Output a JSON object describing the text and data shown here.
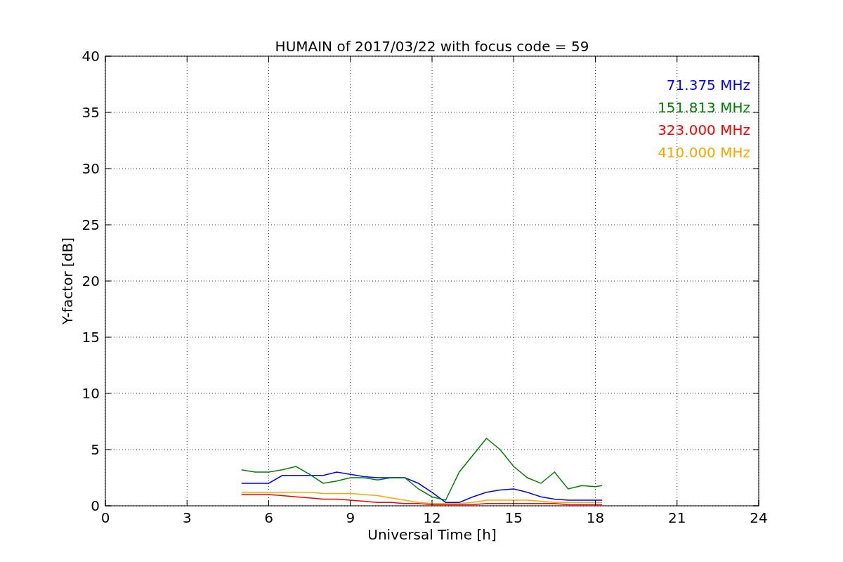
{
  "figure": {
    "chart_data": {
      "type": "line",
      "grid": true,
      "title": "HUMAIN of 2017/03/22 with focus code = 59",
      "xlabel": "Universal Time [h]",
      "ylabel": "Y-factor [dB]",
      "xlim": [
        0,
        24
      ],
      "ylim": [
        0,
        40
      ],
      "xticks": [
        0,
        3,
        6,
        9,
        12,
        15,
        18,
        21,
        24
      ],
      "yticks": [
        0,
        5,
        10,
        15,
        20,
        25,
        30,
        35,
        40
      ],
      "x": [
        5,
        5.5,
        6,
        6.5,
        7,
        7.5,
        8,
        8.5,
        9,
        9.5,
        10,
        10.5,
        11,
        11.5,
        12,
        12.5,
        13,
        13.5,
        14,
        14.5,
        15,
        15.5,
        16,
        16.5,
        17,
        17.5,
        18,
        18.25
      ],
      "series": [
        {
          "name": "71.375 MHz",
          "color": "#0000ff",
          "values": [
            2.0,
            2.0,
            2.0,
            2.7,
            2.7,
            2.7,
            2.7,
            3.0,
            2.8,
            2.6,
            2.5,
            2.5,
            2.5,
            2.0,
            1.2,
            0.3,
            0.3,
            0.8,
            1.2,
            1.4,
            1.5,
            1.2,
            0.8,
            0.6,
            0.5,
            0.5,
            0.5,
            0.5
          ]
        },
        {
          "name": "151.813 MHz",
          "color": "#008000",
          "values": [
            3.2,
            3.0,
            3.0,
            3.2,
            3.5,
            2.8,
            2.0,
            2.2,
            2.5,
            2.5,
            2.3,
            2.5,
            2.5,
            1.5,
            0.8,
            0.5,
            3.0,
            4.5,
            6.0,
            5.0,
            3.5,
            2.5,
            2.0,
            3.0,
            1.5,
            1.8,
            1.7,
            1.8
          ]
        },
        {
          "name": "323.000 MHz",
          "color": "#ff0000",
          "values": [
            1.0,
            1.0,
            1.0,
            0.9,
            0.8,
            0.7,
            0.6,
            0.6,
            0.5,
            0.4,
            0.3,
            0.3,
            0.2,
            0.2,
            0.1,
            0.1,
            0.1,
            0.1,
            0.2,
            0.2,
            0.2,
            0.2,
            0.2,
            0.2,
            0.1,
            0.1,
            0.1,
            0.1
          ]
        },
        {
          "name": "410.000 MHz",
          "color": "#ffa500",
          "values": [
            1.2,
            1.2,
            1.2,
            1.2,
            1.2,
            1.2,
            1.1,
            1.1,
            1.1,
            1.0,
            0.9,
            0.7,
            0.5,
            0.3,
            0.2,
            0.2,
            0.2,
            0.3,
            0.5,
            0.5,
            0.5,
            0.5,
            0.4,
            0.3,
            0.3,
            0.3,
            0.3,
            0.3
          ]
        }
      ]
    }
  }
}
